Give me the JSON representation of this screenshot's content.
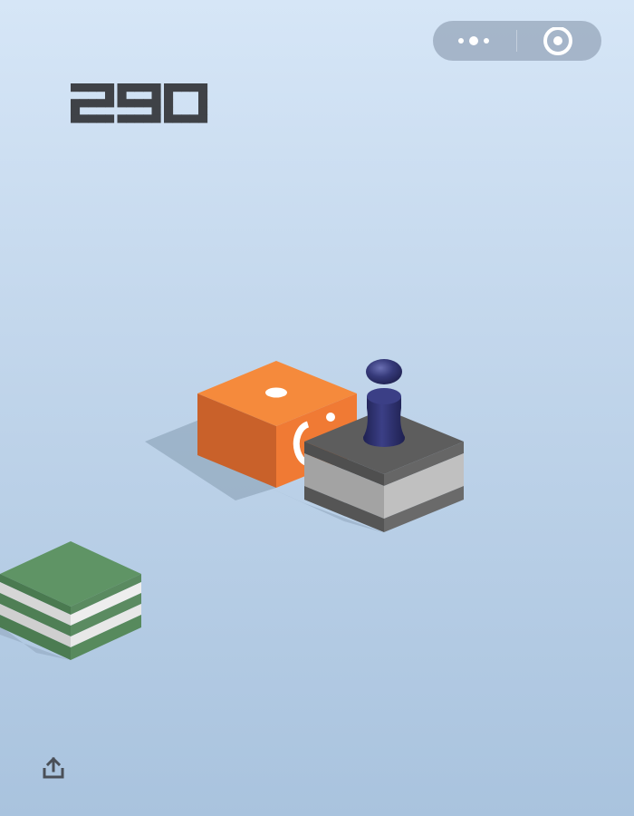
{
  "hud": {
    "score": "290"
  },
  "capsule": {
    "more_icon": "more-dots-icon",
    "close_icon": "target-circle-icon"
  },
  "scene": {
    "platforms": [
      {
        "name": "orange-cube-platform",
        "color": "#f07a34"
      },
      {
        "name": "gray-striped-platform",
        "color": "#636363"
      },
      {
        "name": "green-striped-platform",
        "color": "#5c9162"
      }
    ],
    "player": {
      "name": "player-piece",
      "color": "#2c2e63"
    }
  },
  "share": {
    "icon": "share-upload-icon"
  },
  "colors": {
    "background_top": "#d6e6f7",
    "background_bottom": "#a9c3de",
    "score_text": "#3f4247",
    "orange": "#f07a34",
    "gray": "#636363",
    "green": "#5c9162",
    "player": "#2c2e63"
  }
}
